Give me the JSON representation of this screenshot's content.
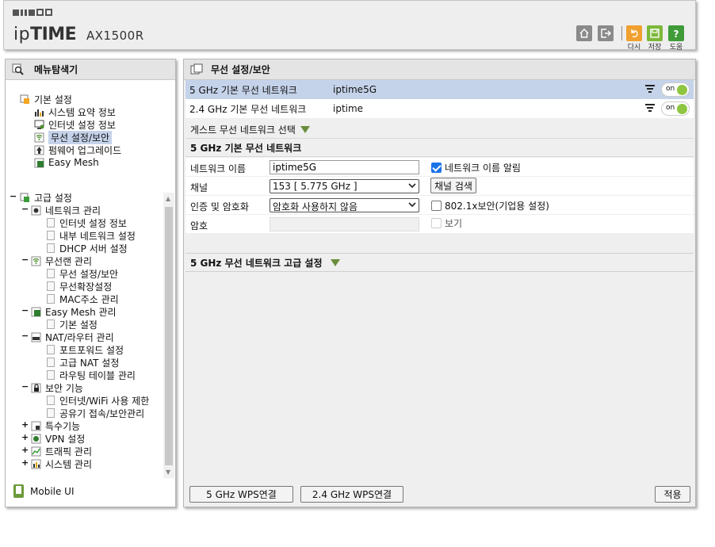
{
  "header": {
    "brand_light": "ip",
    "brand_bold": "TIME",
    "model": "AX1500R",
    "buttons": {
      "logout_label": "다시",
      "save_label": "저장",
      "help_label": "도움"
    }
  },
  "sidebar": {
    "title": "메뉴탐색기",
    "basic": {
      "label": "기본 설정",
      "items": [
        "시스템 요약 정보",
        "인터넷 설정 정보",
        "무선 설정/보안",
        "펌웨어 업그레이드",
        "Easy Mesh"
      ]
    },
    "advanced": {
      "label": "고급 설정",
      "groups": [
        {
          "label": "네트워크 관리",
          "items": [
            "인터넷 설정 정보",
            "내부 네트워크 설정",
            "DHCP 서버 설정"
          ]
        },
        {
          "label": "무선랜 관리",
          "items": [
            "무선 설정/보안",
            "무선확장설정",
            "MAC주소 관리"
          ]
        },
        {
          "label": "Easy Mesh 관리",
          "items": [
            "기본 설정"
          ]
        },
        {
          "label": "NAT/라우터 관리",
          "items": [
            "포트포워드 설정",
            "고급 NAT 설정",
            "라우팅 테이블 관리"
          ]
        },
        {
          "label": "보안 기능",
          "items": [
            "인터넷/WiFi 사용 제한",
            "공유기 접속/보안관리"
          ]
        },
        {
          "label": "특수기능",
          "items": []
        },
        {
          "label": "VPN 설정",
          "items": []
        },
        {
          "label": "트래픽 관리",
          "items": []
        },
        {
          "label": "시스템 관리",
          "items": []
        }
      ]
    },
    "mobile_ui": "Mobile UI"
  },
  "main": {
    "title": "무선 설정/보안",
    "networks": [
      {
        "name": "5 GHz 기본 무선 네트워크",
        "ssid": "iptime5G",
        "toggle": "on"
      },
      {
        "name": "2.4 GHz 기본 무선 네트워크",
        "ssid": "iptime",
        "toggle": "on"
      }
    ],
    "guest_label": "게스트 무선 네트워크 선택",
    "section_title": "5 GHz 기본 무선 네트워크",
    "form": {
      "ssid_label": "네트워크 이름",
      "ssid_value": "iptime5G",
      "broadcast_label": "네트워크 이름 알림",
      "channel_label": "채널",
      "channel_value": "153 [ 5.775 GHz ]",
      "channel_search": "채널 검색",
      "auth_label": "인증 및 암호화",
      "auth_value": "암호화 사용하지 않음",
      "enterprise_label": "802.1x보안(기업용 설정)",
      "password_label": "암호",
      "show_label": "보기"
    },
    "advanced_title": "5 GHz 무선 네트워크 고급 설정",
    "buttons": {
      "wps5": "5 GHz WPS연결",
      "wps24": "2.4 GHz WPS연결",
      "apply": "적용"
    }
  },
  "colors": {
    "selected_row": "#c5d3ea",
    "toggle_on": "#8fc641",
    "accent_triangle": "#6a8f3c"
  }
}
